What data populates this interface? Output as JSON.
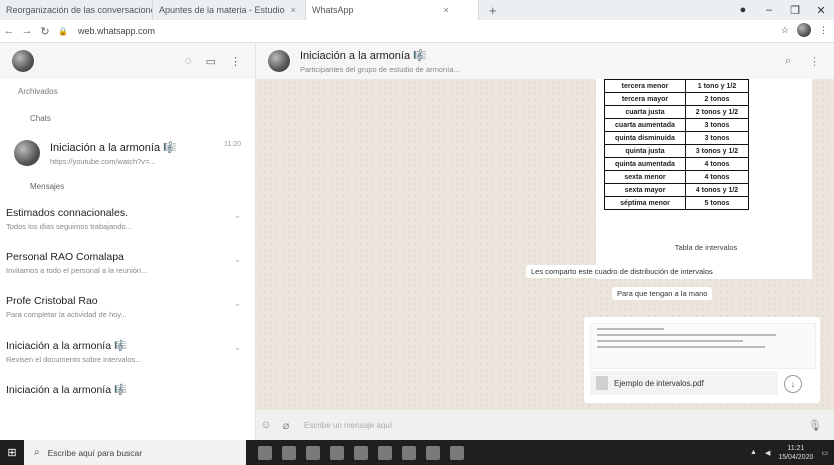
{
  "browser": {
    "tabs": [
      {
        "label": "Reorganización de las conversaciones | Actividad"
      },
      {
        "label": "Apuntes de la materia - Estudio"
      },
      {
        "label": "WhatsApp",
        "active": true
      }
    ],
    "new_tab": "+",
    "url": "web.whatsapp.com"
  },
  "sidebar": {
    "section_chats": "Chats",
    "archived_label": "Archivados",
    "pinned_chat": {
      "name": "Iniciación a la armonía 🎼",
      "snippet": "https://youtube.com/watch?v=...",
      "time": "11:20"
    },
    "section_messages": "Mensajes",
    "chats": [
      {
        "name": "Estimados connacionales.",
        "snippet": "Todos los días seguimos trabajando..."
      },
      {
        "name": "Personal RAO Comalapa",
        "snippet": "Invitamos a todo el personal a la reunión..."
      },
      {
        "name": "Profe Cristobal Rao",
        "snippet": "Para completar la actividad de hoy..."
      },
      {
        "name": "Iniciación a la armonía 🎼",
        "snippet": "Revisen el documento sobre intervalos..."
      },
      {
        "name": "Iniciación a la armonía 🎼",
        "snippet": ""
      }
    ]
  },
  "conversation": {
    "title": "Iniciación a la armonía 🎼",
    "subtitle": "Participantes del grupo de estudio de armonía...",
    "interval_table": [
      [
        "tercera menor",
        "1 tono y 1/2"
      ],
      [
        "tercera mayor",
        "2 tonos"
      ],
      [
        "cuarta justa",
        "2 tonos y 1/2"
      ],
      [
        "cuarta aumentada",
        "3 tonos"
      ],
      [
        "quinta disminuida",
        "3 tonos"
      ],
      [
        "quinta justa",
        "3 tonos y 1/2"
      ],
      [
        "quinta aumentada",
        "4 tonos"
      ],
      [
        "sexta menor",
        "4 tonos"
      ],
      [
        "sexta mayor",
        "4 tonos y 1/2"
      ],
      [
        "séptima menor",
        "5 tonos"
      ]
    ],
    "image_caption": "Tabla de intervalos",
    "messages": [
      "Les comparto este cuadro de distribución de intervalos",
      "Para que tengan a la mano"
    ],
    "document": {
      "filename": "Ejemplo de intervalos.pdf"
    },
    "compose_placeholder": "Escribe un mensaje aquí"
  },
  "taskbar": {
    "search_placeholder": "Escribe aquí para buscar",
    "clock_time": "11:21",
    "clock_date": "15/04/2020"
  }
}
